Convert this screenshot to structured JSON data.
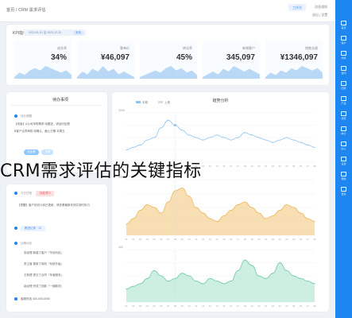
{
  "overlay_title": "CRM需求评估的关键指标",
  "topbar": {
    "crumb": "首页 / CRM 需求评估",
    "user_button": "工作台",
    "right_top": "消息通知",
    "right_bottom": "退出 | 设置"
  },
  "sidebar": {
    "items": [
      "首页",
      "客户",
      "商机",
      "合同",
      "回款",
      "产品",
      "线索",
      "统计",
      "办公",
      "设置",
      "帮助",
      "更多"
    ]
  },
  "kpi": {
    "title": "KPI指标",
    "date_range": "2023-01-01 至 2023-12-31",
    "date_tag": "本年",
    "items": [
      {
        "label": "销售业绩",
        "value": "¥1346,097",
        "spark": [
          3,
          5,
          4,
          6,
          5,
          7,
          6,
          8,
          7,
          6,
          7,
          5
        ]
      },
      {
        "label": "新增客户",
        "value": "345,097",
        "spark": [
          4,
          5,
          6,
          5,
          7,
          6,
          8,
          7,
          6,
          7,
          6,
          5
        ]
      },
      {
        "label": "转化率",
        "value": "45%",
        "spark": [
          3,
          4,
          5,
          6,
          5,
          7,
          8,
          6,
          7,
          5,
          6,
          4
        ]
      },
      {
        "label": "客单价",
        "value": "¥46,097",
        "spark": [
          4,
          6,
          5,
          7,
          6,
          8,
          6,
          7,
          5,
          6,
          5,
          4
        ]
      },
      {
        "label": "成交率",
        "value": "34%",
        "spark": [
          3,
          5,
          4,
          6,
          7,
          6,
          8,
          7,
          6,
          5,
          6,
          4
        ]
      }
    ]
  },
  "todo": {
    "title": "待办事项",
    "header": "待办提醒",
    "rows": [
      "【线索】A公司采购需求 待跟进，请及时处理",
      "B客户合同审批 待确认，截止日期 本周五"
    ],
    "btn_primary": "去处理",
    "btn_secondary": "忽略"
  },
  "todo2": {
    "header": "今日日程",
    "tag_red": "待处理 5",
    "notice": "【提醒】客户回访计划已更新，请查看最新安排并按时执行",
    "pill": "跟进记录 · 12",
    "sub_header": "近期动态",
    "rows": [
      "张经理 新建了客户「华信科技」",
      "李主管 更新了商机「系统升级」",
      "王助理 提交了合同「年度服务」",
      "赵经理 完成了回款「一期款项」"
    ],
    "footer": "客服热线 400-000-0000"
  },
  "chart_data": [
    {
      "type": "line",
      "title": "趋势分析",
      "legend": [
        "本期",
        "上期"
      ],
      "categories": [
        "01",
        "02",
        "03",
        "04",
        "05",
        "06",
        "07",
        "08",
        "09",
        "10",
        "11",
        "12",
        "13",
        "14",
        "15",
        "16",
        "17",
        "18",
        "19",
        "20",
        "21",
        "22",
        "23",
        "24",
        "25",
        "26",
        "27",
        "28"
      ],
      "ylabel": "2000",
      "series": [
        {
          "values": [
            5,
            6,
            7,
            9,
            10,
            14,
            17,
            15,
            13,
            11,
            10,
            9,
            10,
            11,
            10,
            9,
            10,
            12,
            11,
            10,
            9,
            8,
            9,
            10,
            9,
            8,
            7,
            6
          ]
        }
      ],
      "ylim": [
        0,
        20
      ]
    },
    {
      "type": "area",
      "ylabel": "2000",
      "categories": [
        "01",
        "02",
        "03",
        "04",
        "05",
        "06",
        "07",
        "08",
        "09",
        "10",
        "11",
        "12",
        "13",
        "14",
        "15",
        "16",
        "17",
        "18",
        "19",
        "20",
        "21",
        "22",
        "23",
        "24",
        "25",
        "26",
        "27",
        "28"
      ],
      "series": [
        {
          "values": [
            4,
            6,
            9,
            11,
            10,
            8,
            12,
            16,
            17,
            14,
            10,
            8,
            6,
            5,
            7,
            9,
            11,
            12,
            10,
            8,
            6,
            7,
            9,
            11,
            10,
            8,
            6,
            5
          ]
        }
      ],
      "ylim": [
        0,
        20
      ]
    },
    {
      "type": "area",
      "ylabel": "400",
      "categories": [
        "01",
        "02",
        "03",
        "04",
        "05",
        "06",
        "07",
        "08",
        "09",
        "10",
        "11",
        "12",
        "13",
        "14",
        "15",
        "16",
        "17",
        "18",
        "19",
        "20",
        "21",
        "22",
        "23",
        "24",
        "25",
        "26",
        "27",
        "28"
      ],
      "series": [
        {
          "values": [
            5,
            6,
            7,
            9,
            12,
            10,
            8,
            9,
            11,
            10,
            8,
            7,
            9,
            8,
            7,
            8,
            12,
            16,
            14,
            10,
            9,
            11,
            15,
            12,
            10,
            9,
            8,
            7
          ]
        }
      ],
      "ylim": [
        0,
        20
      ]
    }
  ],
  "colors": {
    "accent": "#1e86f0",
    "line": "#8dc3f5",
    "area_orange": "#f6c97c",
    "area_green": "#7fd3b2"
  }
}
